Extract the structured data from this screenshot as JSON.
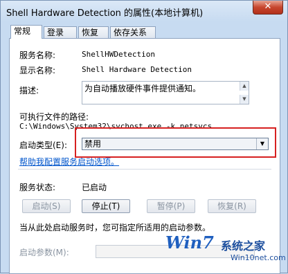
{
  "window": {
    "title": "Shell Hardware Detection 的属性(本地计算机)",
    "close_glyph": "✕"
  },
  "tabs": [
    {
      "label": "常规",
      "active": true
    },
    {
      "label": "登录"
    },
    {
      "label": "恢复"
    },
    {
      "label": "依存关系"
    }
  ],
  "general": {
    "service_name_label": "服务名称:",
    "service_name_value": "ShellHWDetection",
    "display_name_label": "显示名称:",
    "display_name_value": "Shell Hardware Detection",
    "description_label": "描述:",
    "description_value": "为自动播放硬件事件提供通知。",
    "path_label": "可执行文件的路径:",
    "path_value": "C:\\Windows\\System32\\svchost.exe -k netsvcs",
    "startup_type_label": "启动类型(E):",
    "startup_type_value": "禁用",
    "help_link": "帮助我配置服务启动选项。",
    "status_label": "服务状态:",
    "status_value": "已启动",
    "buttons": {
      "start": "启动(S)",
      "stop": "停止(T)",
      "pause": "暂停(P)",
      "resume": "恢复(R)"
    },
    "hint_text": "当从此处启动服务时，您可指定所适用的启动参数。",
    "start_params_label": "启动参数(M):"
  },
  "watermark": {
    "logo_text": "Win7",
    "site_name": "系统之家",
    "url": "Win10net.com"
  }
}
